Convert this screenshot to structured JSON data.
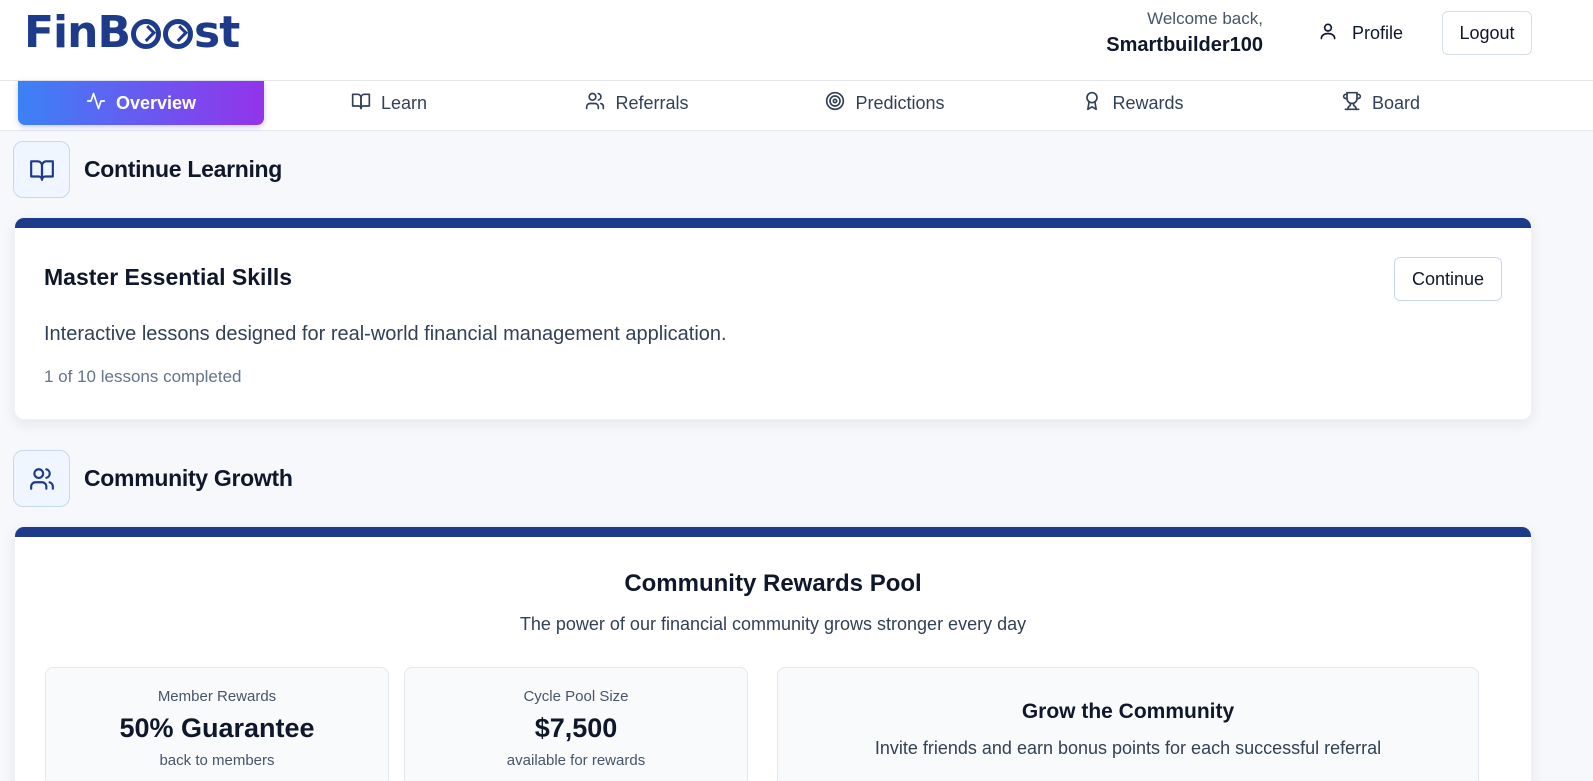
{
  "header": {
    "logo_text": "FinBoost",
    "welcome_label": "Welcome back,",
    "username": "Smartbuilder100",
    "profile_label": "Profile",
    "logout_label": "Logout"
  },
  "tabs": [
    {
      "label": "Overview",
      "icon": "activity-icon",
      "active": true
    },
    {
      "label": "Learn",
      "icon": "book-icon",
      "active": false
    },
    {
      "label": "Referrals",
      "icon": "users-icon",
      "active": false
    },
    {
      "label": "Predictions",
      "icon": "target-icon",
      "active": false
    },
    {
      "label": "Rewards",
      "icon": "award-icon",
      "active": false
    },
    {
      "label": "Board",
      "icon": "trophy-icon",
      "active": false
    }
  ],
  "learning": {
    "section_title": "Continue Learning",
    "card_title": "Master Essential Skills",
    "description": "Interactive lessons designed for real-world financial management application.",
    "progress_text": "1 of 10 lessons completed",
    "continue_label": "Continue"
  },
  "community": {
    "section_title": "Community Growth",
    "pool_title": "Community Rewards Pool",
    "pool_subtitle": "The power of our financial community grows stronger every day",
    "stats": [
      {
        "label": "Member Rewards",
        "value": "50% Guarantee",
        "note": "back to members"
      },
      {
        "label": "Cycle Pool Size",
        "value": "$7,500",
        "note": "available for rewards"
      }
    ],
    "grow_title": "Grow the Community",
    "grow_description": "Invite friends and earn bonus points for each successful referral"
  },
  "colors": {
    "brand": "#1e3a8a",
    "tab_gradient_start": "#3b82f6",
    "tab_gradient_end": "#9333ea"
  }
}
